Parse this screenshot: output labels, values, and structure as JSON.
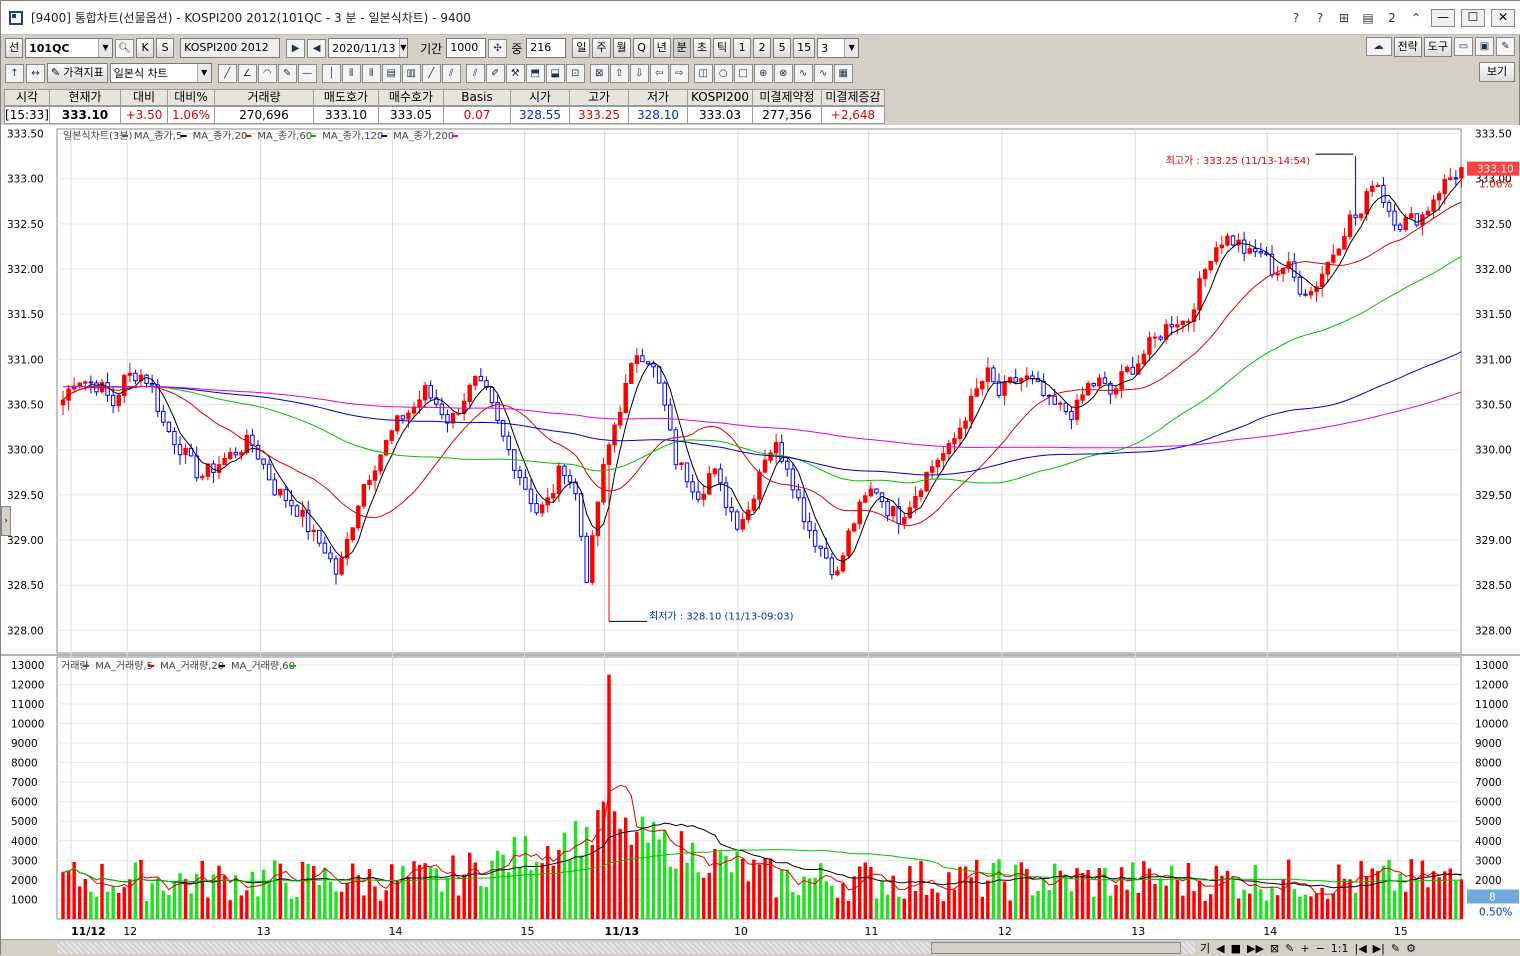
{
  "window": {
    "title": "[9400] 통합차트(선물옵션) - KOSPI200 2012(101QC - 3 분 - 일본식차트) - 9400"
  },
  "titlebar_icons": [
    "?",
    "?",
    "⊞",
    "▤",
    "2",
    "⌃",
    "—",
    "☐",
    "✕"
  ],
  "toolbar1": {
    "mode_label": "선",
    "code": "101QC",
    "btn_search": "Q",
    "btn_k": "K",
    "btn_s": "S",
    "name_label": "KOSPI200 2012",
    "date": "2020/11/13",
    "period_label": "기간",
    "period_value": "1000",
    "zoom_label": "중",
    "zoom_value": "216",
    "intervals": [
      "일",
      "주",
      "월",
      "Q",
      "년",
      "분",
      "초",
      "틱",
      "1",
      "2",
      "5",
      "15"
    ],
    "interval_value": "3",
    "right_buttons": [
      "전략",
      "도구"
    ]
  },
  "toolbar2": {
    "price_indicator": "가격지표",
    "chart_type": "일본식 차트",
    "view_button": "보기"
  },
  "quote": {
    "headers": [
      "시각",
      "현재가",
      "대비",
      "대비%",
      "거래량",
      "매도호가",
      "매수호가",
      "Basis",
      "시가",
      "고가",
      "저가",
      "KOSPI200",
      "미결제약정",
      "미결제증감"
    ],
    "values": [
      "[15:33]",
      "333.10",
      "+3.50",
      "1.06%",
      "270,696",
      "333.10",
      "333.05",
      "0.07",
      "328.55",
      "333.25",
      "328.10",
      "333.03",
      "277,356",
      "+2,648"
    ]
  },
  "chart_data": [
    {
      "type": "candlestick",
      "legend": [
        {
          "name": "일본식차트(3분)",
          "color": "#555555"
        },
        {
          "name": "MA_종가,5",
          "color": "#000000"
        },
        {
          "name": "MA_종가,20",
          "color": "#e00000"
        },
        {
          "name": "MA_종가,60",
          "color": "#00c000"
        },
        {
          "name": "MA_종가,120",
          "color": "#0000c0"
        },
        {
          "name": "MA_종가,200",
          "color": "#e000e0"
        }
      ],
      "legend_text": "일본식차트(3분) - MA_종가,5 - MA_종가,20 - MA_종가,60 - MA_종가,120 - MA_종가,200",
      "ylim": [
        327.75,
        333.55
      ],
      "yticks": [
        "328.00",
        "328.50",
        "329.00",
        "329.50",
        "330.00",
        "330.50",
        "331.00",
        "331.50",
        "332.00",
        "332.50",
        "333.00",
        "333.50"
      ],
      "current_price": "333.10",
      "current_pct": "1.06%",
      "high_annotation": "최고가 : 333.25 (11/13-14:54)",
      "low_annotation": "최저가 : 328.10 (11/13-09:03)",
      "up_color": "#ff0000",
      "down_color": "#0000ff",
      "close_path": [
        330.55,
        330.8,
        330.75,
        330.7,
        330.5,
        330.8,
        330.85,
        330.75,
        330.3,
        330.1,
        329.9,
        329.7,
        329.8,
        329.9,
        330.0,
        330.1,
        329.85,
        329.55,
        329.45,
        329.3,
        329.05,
        328.9,
        328.6,
        329.1,
        329.6,
        329.85,
        330.1,
        330.35,
        330.45,
        330.65,
        330.5,
        330.3,
        330.55,
        330.75,
        330.6,
        330.2,
        329.9,
        329.6,
        329.3,
        329.45,
        329.85,
        329.55,
        328.55,
        329.6,
        330.2,
        330.65,
        331.1,
        331.0,
        330.6,
        329.9,
        329.7,
        329.5,
        329.8,
        329.45,
        329.2,
        329.35,
        329.9,
        330.05,
        329.85,
        329.4,
        329.05,
        328.85,
        328.6,
        329.1,
        329.4,
        329.6,
        329.35,
        329.25,
        329.45,
        329.7,
        329.9,
        330.0,
        330.3,
        330.6,
        330.85,
        330.6,
        330.75,
        330.8,
        330.7,
        330.5,
        330.45,
        330.4,
        330.7,
        330.75,
        330.6,
        330.85,
        330.95,
        331.15,
        331.3,
        331.45,
        331.4,
        331.8,
        332.2,
        332.35,
        332.3,
        332.15,
        332.2,
        331.95,
        332.05,
        331.8,
        331.75,
        332.0,
        332.25,
        332.55,
        332.6,
        333.05,
        332.7,
        332.5,
        332.55,
        332.6,
        332.85,
        333.0,
        333.1
      ]
    },
    {
      "type": "bar",
      "legend": [
        {
          "name": "거래량",
          "color": "#555555"
        },
        {
          "name": "MA_거래량,5",
          "color": "#e00000"
        },
        {
          "name": "MA_거래량,20",
          "color": "#000000"
        },
        {
          "name": "MA_거래량,60",
          "color": "#00c000"
        }
      ],
      "legend_text": "거래량 - MA_거래량,5 - MA_거래량,20 - MA_거래량,60",
      "ylim": [
        0,
        13400
      ],
      "yticks": [
        "1000",
        "2000",
        "3000",
        "4000",
        "5000",
        "6000",
        "7000",
        "8000",
        "9000",
        "10000",
        "11000",
        "12000",
        "13000"
      ],
      "peak_value": 12500,
      "last_value": "8",
      "last_pct": "0.50%"
    }
  ],
  "x_axis": {
    "labels": [
      {
        "text": "11/12",
        "bold": true,
        "pos": 0.01
      },
      {
        "text": "12",
        "bold": false,
        "pos": 0.05
      },
      {
        "text": "13",
        "bold": false,
        "pos": 0.145
      },
      {
        "text": "14",
        "bold": false,
        "pos": 0.239
      },
      {
        "text": "15",
        "bold": false,
        "pos": 0.333
      },
      {
        "text": "11/13",
        "bold": true,
        "pos": 0.39
      },
      {
        "text": "10",
        "bold": false,
        "pos": 0.485
      },
      {
        "text": "11",
        "bold": false,
        "pos": 0.578
      },
      {
        "text": "12",
        "bold": false,
        "pos": 0.673
      },
      {
        "text": "13",
        "bold": false,
        "pos": 0.768
      },
      {
        "text": "14",
        "bold": false,
        "pos": 0.862
      },
      {
        "text": "15",
        "bold": false,
        "pos": 0.955
      }
    ]
  },
  "scroll_controls": [
    "기",
    "◀",
    "■",
    "▶▶",
    "⊠",
    "✎",
    "+",
    "−",
    "1:1",
    "|◀",
    "▶|",
    "✎",
    "⚙"
  ]
}
